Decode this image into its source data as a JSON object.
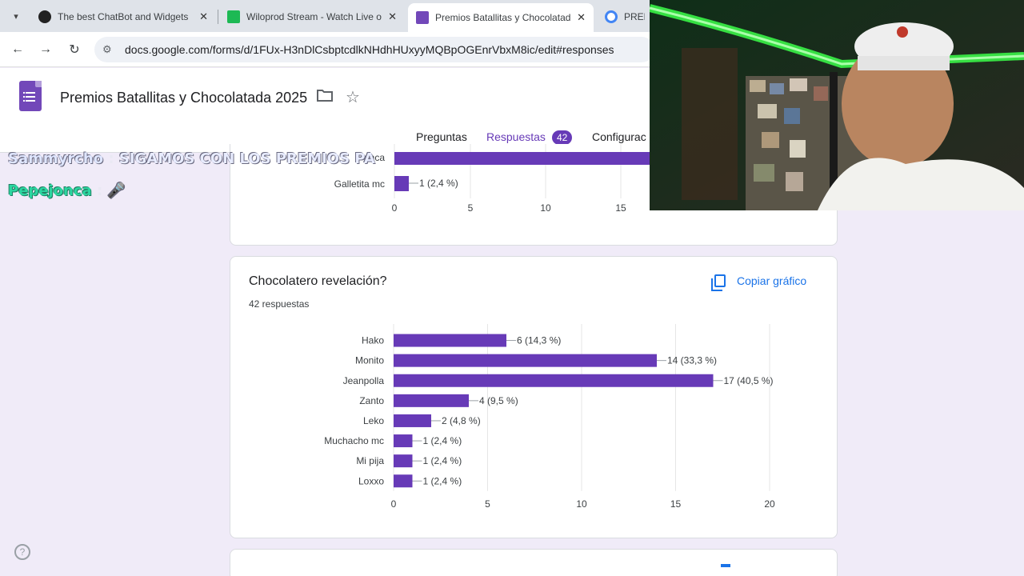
{
  "browser": {
    "tabs": [
      {
        "title": "The best ChatBot and Widgets"
      },
      {
        "title": "Wiloprod Stream - Watch Live o"
      },
      {
        "title": "Premios Batallitas y Chocolatad"
      },
      {
        "title": "PREMI"
      }
    ],
    "url": "docs.google.com/forms/d/1FUx-H3nDlCsbptcdlkNHdhHUxyyMQBpOGEnrVbxM8ic/edit#responses"
  },
  "form": {
    "title": "Premios Batallitas y Chocolatada 2025",
    "nav": {
      "preguntas": "Preguntas",
      "respuestas": "Respuestas",
      "respuestas_count": "42",
      "configuracion": "Configurac"
    }
  },
  "prev_chart": {
    "visible_labels": [
      "onca",
      "Galletita mc"
    ],
    "galletita_label": "1 (2,4 %)",
    "galletita_value": 1,
    "ticks": [
      "0",
      "5",
      "10",
      "15"
    ]
  },
  "question": {
    "title": "Chocolatero revelación?",
    "responses": "42 respuestas",
    "copy_label": "Copiar gráfico"
  },
  "chart_data": {
    "type": "bar",
    "orientation": "horizontal",
    "categories": [
      "Hako",
      "Monito",
      "Jeanpolla",
      "Zanto",
      "Leko",
      "Muchacho mc",
      "Mi pija",
      "Loxxo"
    ],
    "values": [
      6,
      14,
      17,
      4,
      2,
      1,
      1,
      1
    ],
    "data_labels": [
      "6 (14,3 %)",
      "14 (33,3 %)",
      "17 (40,5 %)",
      "4 (9,5 %)",
      "2 (4,8 %)",
      "1 (2,4 %)",
      "1 (2,4 %)",
      "1 (2,4 %)"
    ],
    "xlim": [
      0,
      20
    ],
    "xticks": [
      "0",
      "5",
      "10",
      "15",
      "20"
    ],
    "bar_color": "#673ab7",
    "grid": true
  },
  "chat": [
    {
      "user": "Sammyrcho",
      "message": "SIGAMOS CON LOS PREMIOS PA"
    },
    {
      "user": "Pepejonca",
      "message": "🎤"
    }
  ],
  "colors": {
    "accent": "#673ab7",
    "page_bg": "#f0ebf8",
    "link": "#1a73e8"
  }
}
